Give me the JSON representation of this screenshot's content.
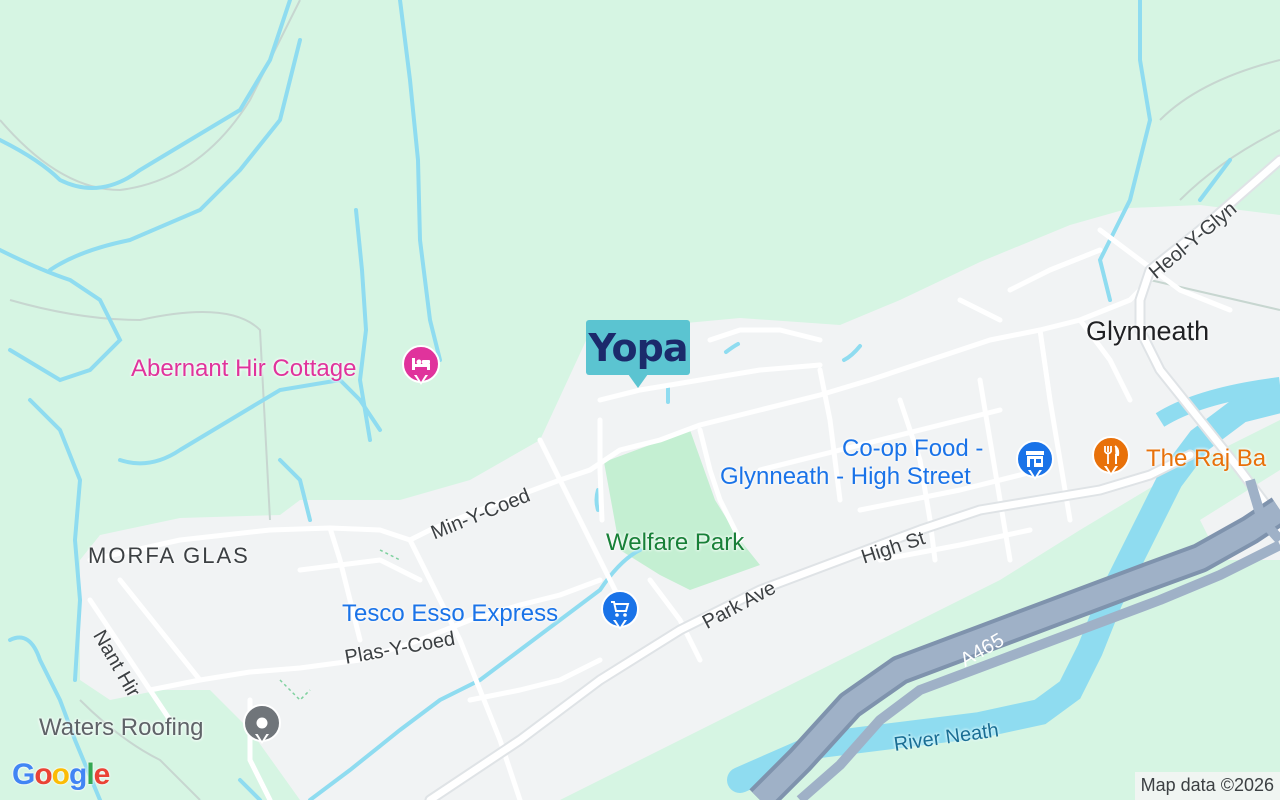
{
  "brand_marker": {
    "text": "Yopa",
    "color": "#5bc4d1",
    "text_color": "#1b2a6b"
  },
  "places": [
    {
      "name": "Glynneath",
      "kind": "town"
    },
    {
      "name": "MORFA GLAS",
      "kind": "district"
    }
  ],
  "streets": [
    "Min-Y-Coed",
    "Plas-Y-Coed",
    "Nant Hir",
    "Park Ave",
    "High St",
    "Heol-Y-Glyn"
  ],
  "road_shield": {
    "label": "A465"
  },
  "water": {
    "river": "River Neath"
  },
  "pois": [
    {
      "name": "Abernant Hir Cottage",
      "category": "lodging",
      "icon": "bed-icon",
      "color": "#e0339c"
    },
    {
      "name": "Co-op Food - Glynneath - High Street",
      "lines": [
        "Co-op Food -",
        "Glynneath - High Street"
      ],
      "category": "shopping",
      "icon": "store-icon",
      "color": "#1a73e8"
    },
    {
      "name": "The Raj Ba",
      "category": "restaurant",
      "icon": "fork-knife-icon",
      "color": "#e8710a"
    },
    {
      "name": "Welfare Park",
      "category": "park",
      "icon": null,
      "color": "#188038"
    },
    {
      "name": "Tesco Esso Express",
      "category": "shopping",
      "icon": "shopping-cart-icon",
      "color": "#1a73e8"
    },
    {
      "name": "Waters Roofing",
      "category": "business",
      "icon": "dot-icon",
      "color": "#70757a"
    }
  ],
  "footer": {
    "logo": "Google",
    "attribution": "Map data ©2026"
  },
  "colors": {
    "land_background": "#d6f5e3",
    "urban": "#f1f3f4",
    "park": "#c4efd2",
    "water": "#8fdcf0",
    "road": "#ffffff",
    "motorway": "#8a9db5"
  }
}
